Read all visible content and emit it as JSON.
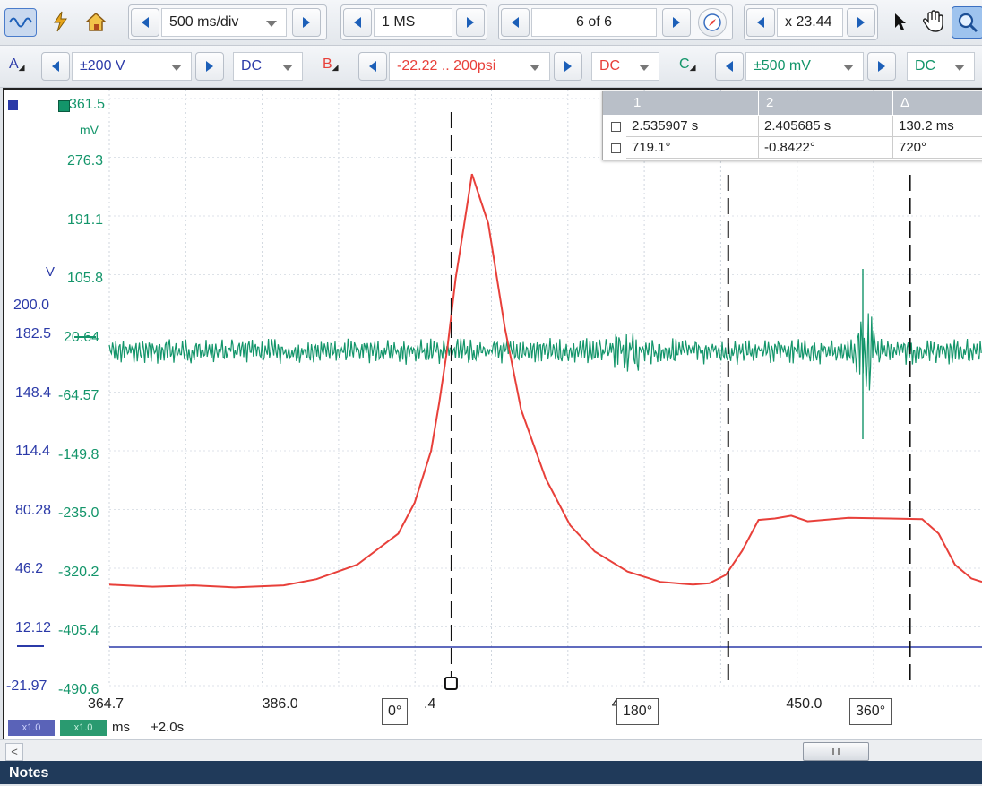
{
  "toolbar": {
    "timebase": "500 ms/div",
    "samples": "1 MS",
    "buffer": "6 of 6",
    "zoom": "x 23.44"
  },
  "channels": {
    "a": {
      "letter": "A",
      "range": "±200 V",
      "coupling": "DC",
      "color": "#2b3aa8"
    },
    "b": {
      "letter": "B",
      "range": "-22.22 .. 200psi",
      "coupling": "DC",
      "color": "#e8403a"
    },
    "c": {
      "letter": "C",
      "range": "±500 mV",
      "coupling": "DC",
      "color": "#13956a"
    }
  },
  "axes": {
    "c_unit": "mV",
    "a_unit": "V",
    "c_top": "361.5",
    "c_ticks": [
      "276.3",
      "191.1",
      "105.8",
      "20.64",
      "-64.57",
      "-149.8",
      "-235.0",
      "-320.2",
      "-405.4",
      "-490.6"
    ],
    "a_ticks": [
      "200.0",
      "182.5",
      "148.4",
      "114.4",
      "80.28",
      "46.2",
      "12.12",
      "-21.97"
    ],
    "x_ticks": [
      "364.7",
      "386.0",
      "428.7",
      "450.0"
    ],
    "x_partial": ".4",
    "x_unit": "ms",
    "x_offset": "+2.0s",
    "scale_a": "x1.0",
    "scale_c": "x1.0"
  },
  "phase_labels": [
    "0°",
    "180°",
    "360°"
  ],
  "cursor_table": {
    "headers": [
      "1",
      "2",
      "Δ"
    ],
    "rows": [
      [
        "2.535907 s",
        "2.405685 s",
        "130.2 ms"
      ],
      [
        "719.1°",
        "-0.8422°",
        "720°"
      ]
    ]
  },
  "notes_title": "Notes",
  "chart_data": {
    "type": "line",
    "xlabel": "ms",
    "xlim": [
      364.7,
      471.3
    ],
    "series": [
      {
        "channel": "B",
        "color": "#e8403a",
        "x": [
          364.7,
          370,
          375,
          380,
          386,
          390,
          395,
          400,
          402,
          404,
          405,
          406,
          407,
          408,
          409,
          411,
          413,
          415,
          418,
          421,
          424,
          428,
          432,
          434,
          436,
          438,
          440,
          442,
          444,
          446,
          448,
          450,
          455,
          460,
          464,
          466,
          468,
          470,
          471.3
        ],
        "y": [
          -344,
          -347,
          -345,
          -348,
          -345,
          -336,
          -315,
          -270,
          -225,
          -150,
          -80,
          0,
          100,
          175,
          252,
          180,
          30,
          -90,
          -190,
          -258,
          -296,
          -325,
          -340,
          -342,
          -344,
          -342,
          -330,
          -295,
          -250,
          -248,
          -244,
          -252,
          -247,
          -248,
          -249,
          -270,
          -315,
          -335,
          -340
        ]
      },
      {
        "channel": "C",
        "color": "#13956a",
        "mean_mV": -20,
        "noise_mV": 12
      }
    ],
    "cursors": [
      {
        "x": 406.5,
        "label": "0°"
      },
      {
        "x": 440.3,
        "label": "180°"
      },
      {
        "x": 462.5,
        "label": "360°"
      }
    ]
  }
}
